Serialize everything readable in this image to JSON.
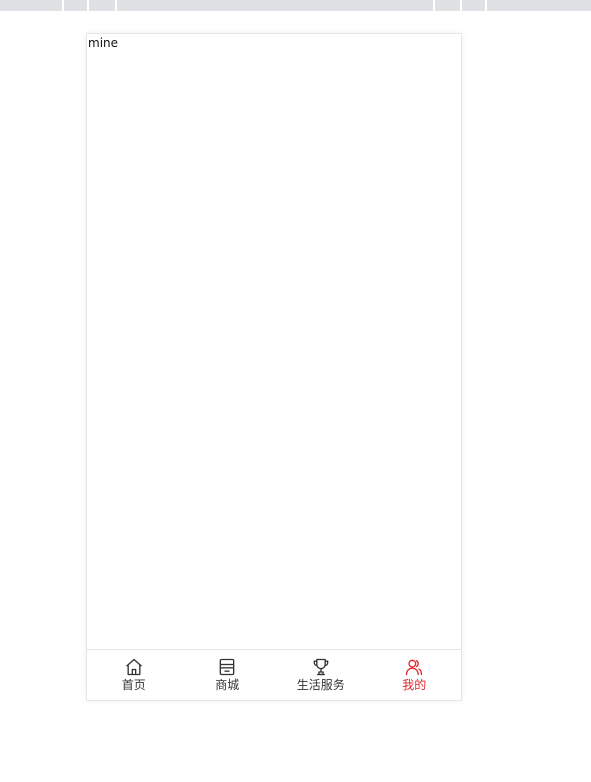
{
  "page": {
    "content_text": "mine"
  },
  "tabbar": {
    "active_color": "#e6242b",
    "inactive_color": "#333333",
    "items": [
      {
        "label": "首页",
        "icon": "home-icon",
        "active": false
      },
      {
        "label": "商城",
        "icon": "shop-icon",
        "active": false
      },
      {
        "label": "生活服务",
        "icon": "trophy-icon",
        "active": false
      },
      {
        "label": "我的",
        "icon": "user-icon",
        "active": true
      }
    ]
  }
}
